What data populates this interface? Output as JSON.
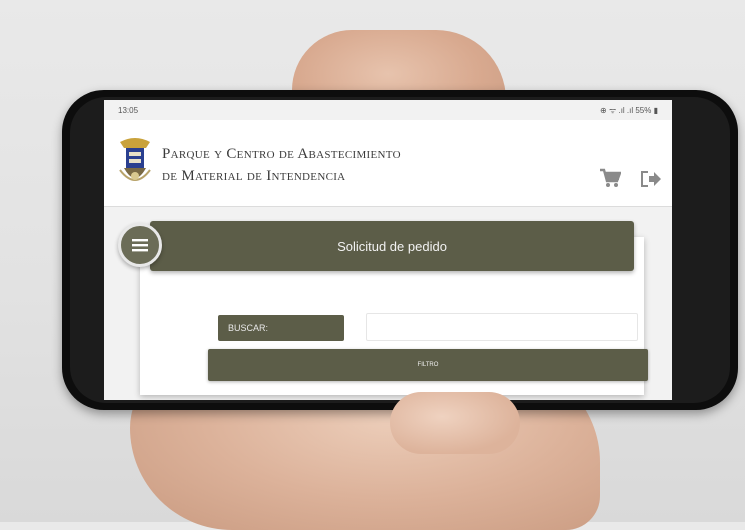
{
  "status_bar": {
    "time": "13:05",
    "indicators": "⊕ ᯤ .ıl .ıl 55% ▮"
  },
  "header": {
    "title_line1": "Parque y Centro de Abastecimiento",
    "title_line2": "de Material de Intendencia",
    "icons": [
      "coat-of-arms-logo",
      "cart-icon",
      "logout-icon"
    ]
  },
  "main": {
    "section_title": "Solicitud de pedido",
    "menu_icon": "hamburger-icon",
    "search_label": "BUSCAR:",
    "search_value": "",
    "filter_button": "FILTRO"
  },
  "colors": {
    "accent": "#5c5d48",
    "header_bg": "#ffffff",
    "page_bg": "#f2f2f2"
  }
}
